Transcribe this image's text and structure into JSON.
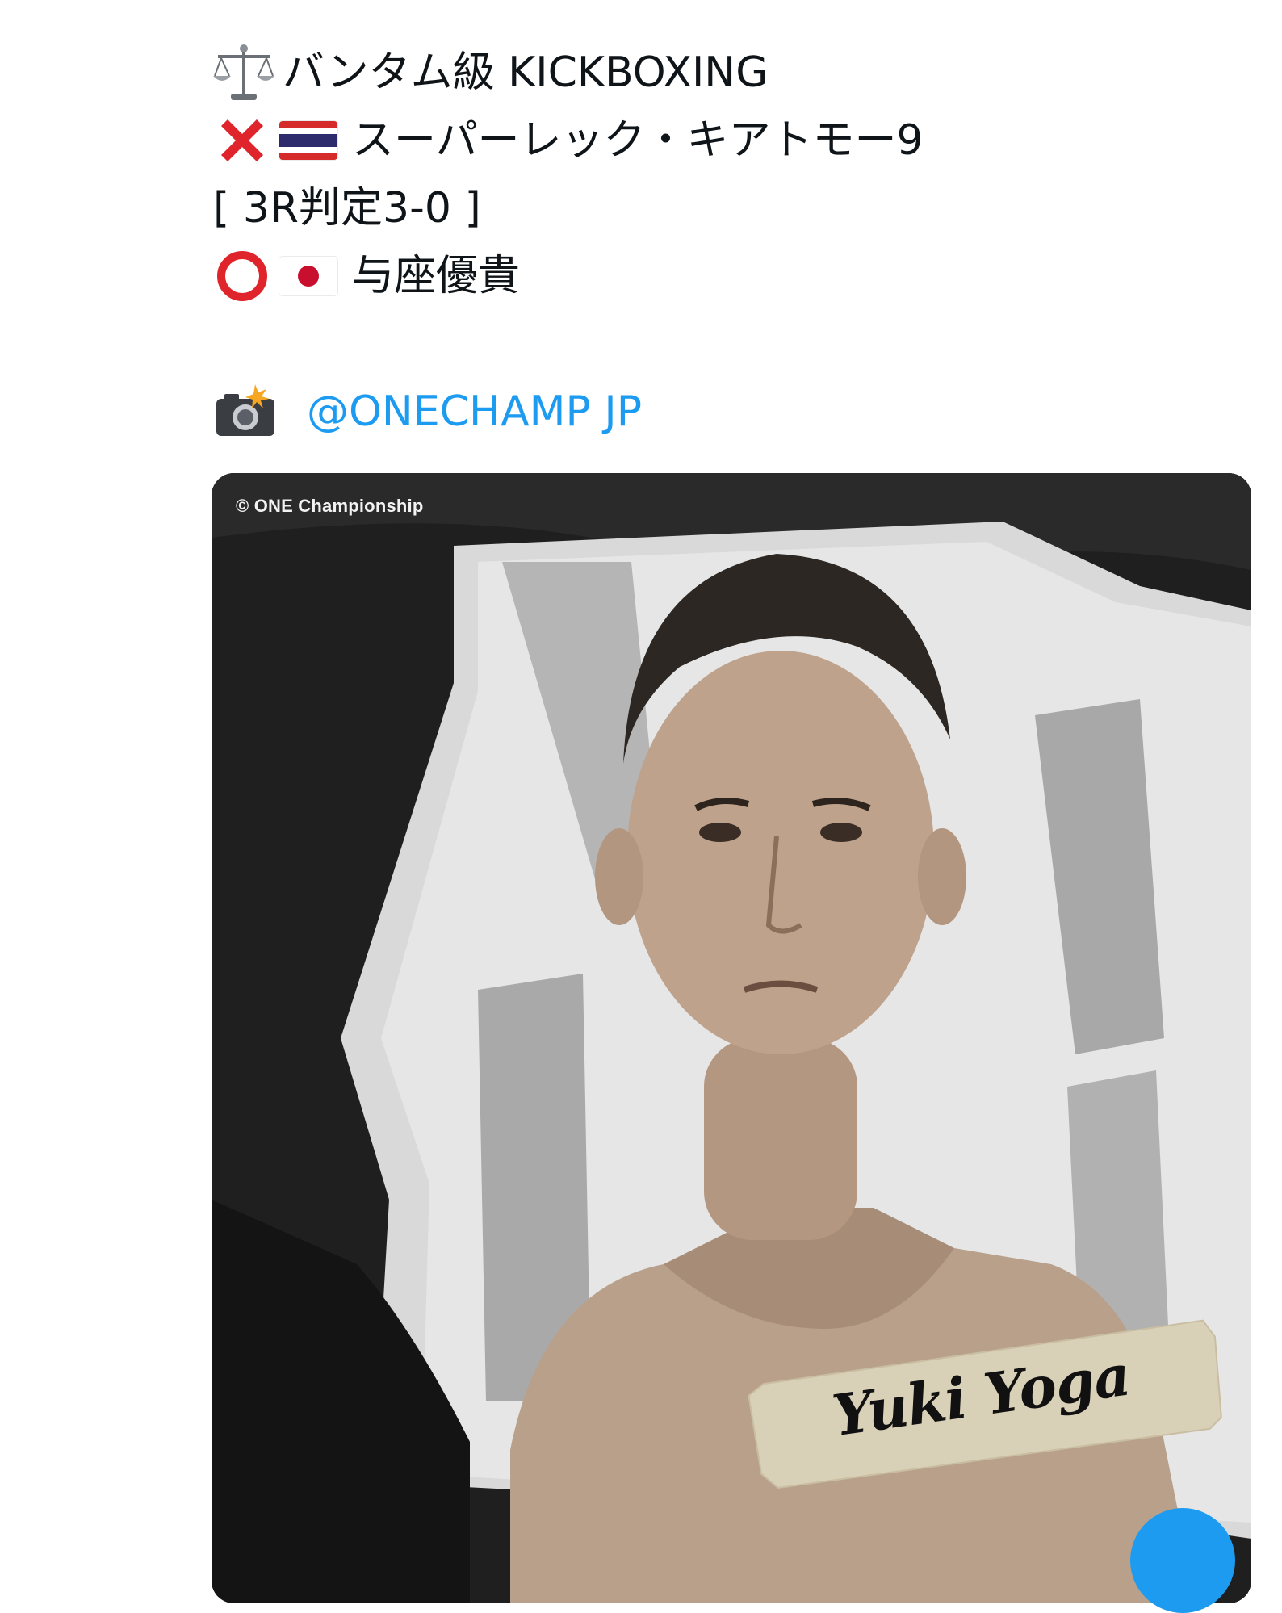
{
  "tweet": {
    "lines": {
      "weight_class": "バンタム級 KICKBOXING",
      "loser": "スーパーレック・キアトモー9",
      "result": "[ 3R判定3-0 ]",
      "winner": "与座優貴"
    },
    "emoji": {
      "scale": "balance-scale-icon",
      "loss": "cross-mark-icon",
      "win": "hollow-red-circle-icon",
      "camera": "camera-with-flash-icon"
    },
    "flags": {
      "loser": "Thailand",
      "winner": "Japan"
    },
    "mention": "@ONECHAMP JP"
  },
  "media": {
    "watermark": "© ONE Championship",
    "signature_name": "Yuki Yoga"
  },
  "colors": {
    "link": "#1d9bf0",
    "text": "#0f1419",
    "cross": "#e0242b",
    "circle": "#e0242b"
  }
}
